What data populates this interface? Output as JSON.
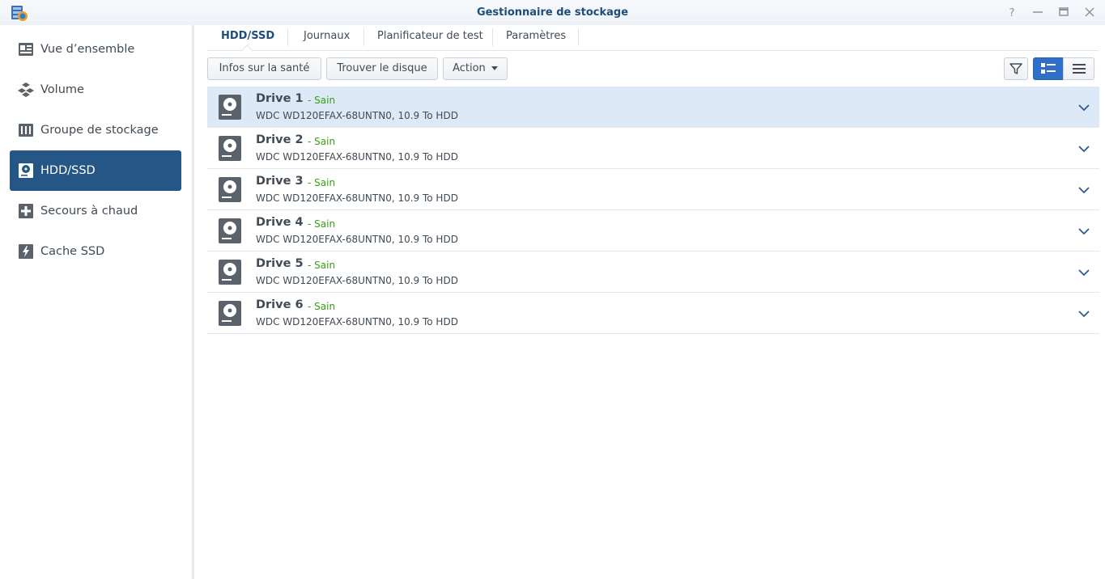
{
  "window": {
    "title": "Gestionnaire de stockage",
    "help_label": "?"
  },
  "sidebar": {
    "items": [
      {
        "label": "Vue d’ensemble",
        "icon": "overview-icon",
        "active": false
      },
      {
        "label": "Volume",
        "icon": "volume-icon",
        "active": false
      },
      {
        "label": "Groupe de stockage",
        "icon": "storage-pool-icon",
        "active": false
      },
      {
        "label": "HDD/SSD",
        "icon": "hdd-icon",
        "active": true
      },
      {
        "label": "Secours à chaud",
        "icon": "hot-spare-icon",
        "active": false
      },
      {
        "label": "Cache SSD",
        "icon": "ssd-cache-icon",
        "active": false
      }
    ]
  },
  "tabs": [
    {
      "label": "HDD/SSD",
      "active": true
    },
    {
      "label": "Journaux",
      "active": false
    },
    {
      "label": "Planificateur de test",
      "active": false
    },
    {
      "label": "Paramètres",
      "active": false
    }
  ],
  "toolbar": {
    "health_info_label": "Infos sur la santé",
    "find_disk_label": "Trouver le disque",
    "action_label": "Action",
    "filter_icon": "filter-icon",
    "detail_view_icon": "detail-view-icon",
    "list_view_icon": "list-view-icon",
    "active_view": "detail"
  },
  "drives": [
    {
      "name": "Drive 1",
      "status": "- Sain",
      "description": "WDC WD120EFAX-68UNTN0, 10.9 To HDD",
      "selected": true
    },
    {
      "name": "Drive 2",
      "status": "- Sain",
      "description": "WDC WD120EFAX-68UNTN0, 10.9 To HDD",
      "selected": false
    },
    {
      "name": "Drive 3",
      "status": "- Sain",
      "description": "WDC WD120EFAX-68UNTN0, 10.9 To HDD",
      "selected": false
    },
    {
      "name": "Drive 4",
      "status": "- Sain",
      "description": "WDC WD120EFAX-68UNTN0, 10.9 To HDD",
      "selected": false
    },
    {
      "name": "Drive 5",
      "status": "- Sain",
      "description": "WDC WD120EFAX-68UNTN0, 10.9 To HDD",
      "selected": false
    },
    {
      "name": "Drive 6",
      "status": "- Sain",
      "description": "WDC WD120EFAX-68UNTN0, 10.9 To HDD",
      "selected": false
    }
  ],
  "colors": {
    "accent": "#255685",
    "title": "#1e4d79",
    "status_ok": "#37a012",
    "selected_row": "#dde9f6"
  }
}
